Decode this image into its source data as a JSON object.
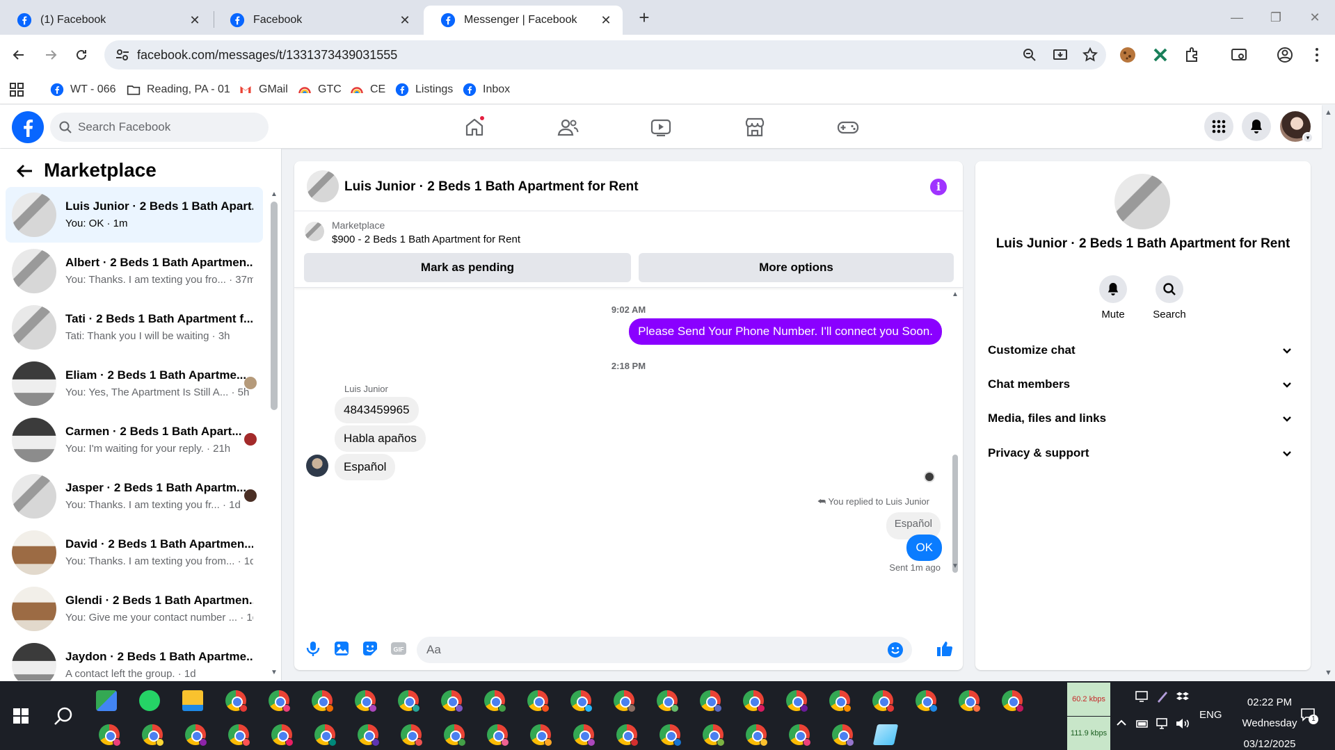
{
  "browser": {
    "tabs": [
      {
        "title": "(1) Facebook",
        "active": false
      },
      {
        "title": "Facebook",
        "active": false
      },
      {
        "title": "Messenger | Facebook",
        "active": true
      }
    ],
    "url": "facebook.com/messages/t/1331373439031555",
    "bookmarks": [
      {
        "label": "WT - 066",
        "icon": "facebook-icon"
      },
      {
        "label": "Reading, PA - 01",
        "icon": "folder-icon"
      },
      {
        "label": "GMail",
        "icon": "gmail-icon"
      },
      {
        "label": "GTC",
        "icon": "rainbow-icon"
      },
      {
        "label": "CE",
        "icon": "rainbow-icon"
      },
      {
        "label": "Listings",
        "icon": "facebook-icon"
      },
      {
        "label": "Inbox",
        "icon": "facebook-icon"
      }
    ]
  },
  "fb": {
    "search_placeholder": "Search Facebook",
    "brand_color": "#0866ff"
  },
  "sidebar": {
    "title": "Marketplace",
    "conversations": [
      {
        "name": "Luis Junior · 2 Beds 1 Bath Apart...",
        "snippet": "You: OK · 1m",
        "selected": true
      },
      {
        "name": "Albert · 2 Beds 1 Bath Apartmen...",
        "snippet": "You: Thanks. I am texting you fro... · 37m"
      },
      {
        "name": "Tati · 2 Beds 1 Bath Apartment f...",
        "snippet": "Tati: Thank you I will be waiting · 3h"
      },
      {
        "name": "Eliam · 2 Beds 1 Bath Apartme...",
        "snippet": "You: Yes, The Apartment Is Still A... · 5h"
      },
      {
        "name": "Carmen · 2 Beds 1 Bath Apart...",
        "snippet": "You: I'm waiting for your reply. · 21h"
      },
      {
        "name": "Jasper · 2 Beds 1 Bath Apartm...",
        "snippet": "You: Thanks. I am texting you fr... · 1d"
      },
      {
        "name": "David · 2 Beds 1 Bath Apartmen...",
        "snippet": "You: Thanks. I am texting you from... · 1d"
      },
      {
        "name": "Glendi · 2 Beds 1 Bath Apartmen...",
        "snippet": "You: Give me your contact number ... · 1d"
      },
      {
        "name": "Jaydon · 2 Beds 1 Bath Apartme...",
        "snippet": "A contact left the group. · 1d"
      }
    ]
  },
  "chat": {
    "title": "Luis Junior · 2 Beds 1 Bath Apartment for Rent",
    "marketplace_label": "Marketplace",
    "listing": "$900 - 2 Beds 1 Bath Apartment for Rent",
    "btn_pending": "Mark as pending",
    "btn_more": "More options",
    "ts1": "9:02 AM",
    "out_msg": "Please Send Your Phone Number. I'll connect you Soon.",
    "ts2": "2:18 PM",
    "sender": "Luis Junior",
    "in_msgs": [
      "4843459965",
      "Habla apaños",
      "Español"
    ],
    "reply_note": "You replied to Luis Junior",
    "quoted": "Español",
    "reply": "OK",
    "sent": "Sent 1m ago",
    "composer_placeholder": "Aa",
    "accent": "#8a00ff"
  },
  "panel": {
    "name": "Luis Junior · 2 Beds 1 Bath Apartment for Rent",
    "mute": "Mute",
    "search": "Search",
    "sections": [
      "Customize chat",
      "Chat members",
      "Media, files and links",
      "Privacy & support"
    ]
  },
  "taskbar": {
    "net_up": "60.2 kbps",
    "net_down": "111.9 kbps",
    "lang": "ENG",
    "time": "02:22 PM",
    "day": "Wednesday",
    "date": "03/12/2025",
    "notif_count": "1"
  }
}
